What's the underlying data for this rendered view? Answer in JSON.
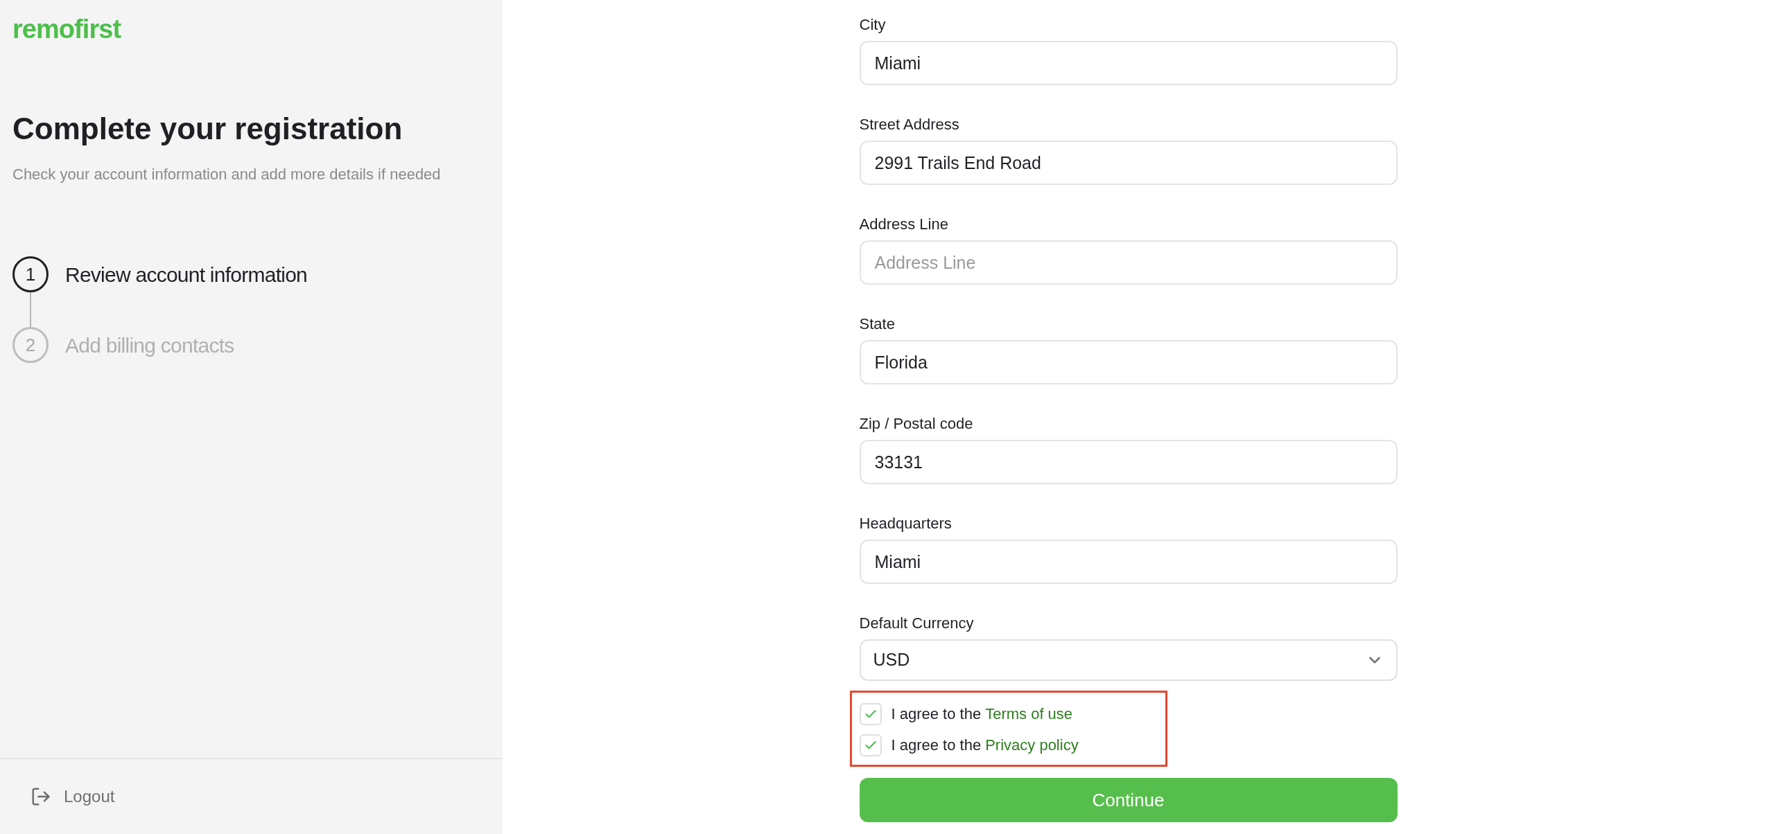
{
  "sidebar": {
    "logo": "remofirst",
    "title": "Complete your registration",
    "subtitle": "Check your account information and add more details if needed",
    "steps": [
      {
        "number": "1",
        "label": "Review account information",
        "active": true
      },
      {
        "number": "2",
        "label": "Add billing contacts",
        "active": false
      }
    ],
    "logout": "Logout"
  },
  "form": {
    "fields": [
      {
        "kind": "input",
        "label": "City",
        "value": "Miami"
      },
      {
        "kind": "input",
        "label": "Street Address",
        "value": "2991 Trails End Road"
      },
      {
        "kind": "input",
        "label": "Address Line",
        "placeholder": "Address Line"
      },
      {
        "kind": "input",
        "label": "State",
        "value": "Florida"
      },
      {
        "kind": "input",
        "label": "Zip / Postal code",
        "value": "33131"
      },
      {
        "kind": "input",
        "label": "Headquarters",
        "value": "Miami"
      },
      {
        "kind": "select",
        "label": "Default Currency",
        "value": "USD"
      }
    ],
    "agreements": [
      {
        "text": "I agree to the",
        "link": "Terms of use",
        "checked": true
      },
      {
        "text": "I agree to the",
        "link": "Privacy policy",
        "checked": true
      }
    ],
    "submit": "Continue"
  }
}
